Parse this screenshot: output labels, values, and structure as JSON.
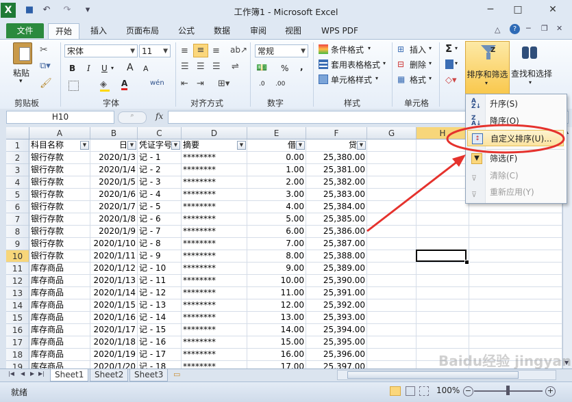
{
  "window": {
    "title": "工作簿1 - Microsoft Excel",
    "min_label": "─",
    "max_label": "□",
    "close_label": "✕"
  },
  "qat": {
    "save": "💾",
    "undo": "↶",
    "redo": "↷",
    "more": "▾"
  },
  "tabs": [
    "文件",
    "开始",
    "插入",
    "页面布局",
    "公式",
    "数据",
    "审阅",
    "视图",
    "WPS PDF"
  ],
  "ribbon": {
    "clipboard": {
      "paste": "粘贴",
      "label": "剪贴板"
    },
    "font": {
      "name": "宋体",
      "size": "11",
      "bold": "B",
      "italic": "I",
      "underline": "U",
      "grow": "A",
      "shrink": "A",
      "wen": "wén",
      "label": "字体"
    },
    "align": {
      "label": "对齐方式"
    },
    "number": {
      "format": "常规",
      "percent": "%",
      "comma": ",",
      "dec_inc": ".0",
      "dec_dec": ".00",
      "label": "数字"
    },
    "styles": {
      "cond": "条件格式",
      "table": "套用表格格式",
      "cell": "单元格样式",
      "label": "样式"
    },
    "cells": {
      "insert": "插入",
      "delete": "删除",
      "format": "格式",
      "label": "单元格"
    },
    "editing": {
      "sum": "Σ",
      "sort": "排序和筛选",
      "find": "查找和选择"
    }
  },
  "formula": {
    "namebox": "H10",
    "fx": "fx",
    "value": ""
  },
  "columns": [
    "A",
    "B",
    "C",
    "D",
    "E",
    "F",
    "G",
    "H"
  ],
  "headers": [
    "科目名称",
    "日期",
    "凭证字号",
    "摘要",
    "借方",
    "贷方"
  ],
  "rows": [
    [
      "银行存款",
      "2020/1/3",
      "记 - 1",
      "********",
      "0.00",
      "25,380.00"
    ],
    [
      "银行存款",
      "2020/1/4",
      "记 - 2",
      "********",
      "1.00",
      "25,381.00"
    ],
    [
      "银行存款",
      "2020/1/5",
      "记 - 3",
      "********",
      "2.00",
      "25,382.00"
    ],
    [
      "银行存款",
      "2020/1/6",
      "记 - 4",
      "********",
      "3.00",
      "25,383.00"
    ],
    [
      "银行存款",
      "2020/1/7",
      "记 - 5",
      "********",
      "4.00",
      "25,384.00"
    ],
    [
      "银行存款",
      "2020/1/8",
      "记 - 6",
      "********",
      "5.00",
      "25,385.00"
    ],
    [
      "银行存款",
      "2020/1/9",
      "记 - 7",
      "********",
      "6.00",
      "25,386.00"
    ],
    [
      "银行存款",
      "2020/1/10",
      "记 - 8",
      "********",
      "7.00",
      "25,387.00"
    ],
    [
      "银行存款",
      "2020/1/11",
      "记 - 9",
      "********",
      "8.00",
      "25,388.00"
    ],
    [
      "库存商品",
      "2020/1/12",
      "记 - 10",
      "********",
      "9.00",
      "25,389.00"
    ],
    [
      "库存商品",
      "2020/1/13",
      "记 - 11",
      "********",
      "10.00",
      "25,390.00"
    ],
    [
      "库存商品",
      "2020/1/14",
      "记 - 12",
      "********",
      "11.00",
      "25,391.00"
    ],
    [
      "库存商品",
      "2020/1/15",
      "记 - 13",
      "********",
      "12.00",
      "25,392.00"
    ],
    [
      "库存商品",
      "2020/1/16",
      "记 - 14",
      "********",
      "13.00",
      "25,393.00"
    ],
    [
      "库存商品",
      "2020/1/17",
      "记 - 15",
      "********",
      "14.00",
      "25,394.00"
    ],
    [
      "库存商品",
      "2020/1/18",
      "记 - 16",
      "********",
      "15.00",
      "25,395.00"
    ],
    [
      "库存商品",
      "2020/1/19",
      "记 - 17",
      "********",
      "16.00",
      "25,396.00"
    ],
    [
      "库存商品",
      "2020/1/20",
      "记 - 18",
      "********",
      "17.00",
      "25,397.00"
    ]
  ],
  "row_numbers": [
    "1",
    "2",
    "3",
    "4",
    "5",
    "6",
    "7",
    "8",
    "9",
    "10",
    "11",
    "12",
    "13",
    "14",
    "15",
    "16",
    "17",
    "18",
    "19"
  ],
  "sheets": [
    "Sheet1",
    "Sheet2",
    "Sheet3"
  ],
  "status": {
    "ready": "就绪",
    "zoom": "100%"
  },
  "menu": {
    "asc": "升序(S)",
    "desc": "降序(O)",
    "custom": "自定义排序(U)...",
    "filter": "筛选(F)",
    "clear": "清除(C)",
    "reapply": "重新应用(Y)"
  },
  "watermark": "Baidu经验 jingyan.baidu.com",
  "colors": {
    "file_tab": "#2b8a3e",
    "highlight_ring": "#e5322d",
    "selection": "#f7d67a"
  }
}
